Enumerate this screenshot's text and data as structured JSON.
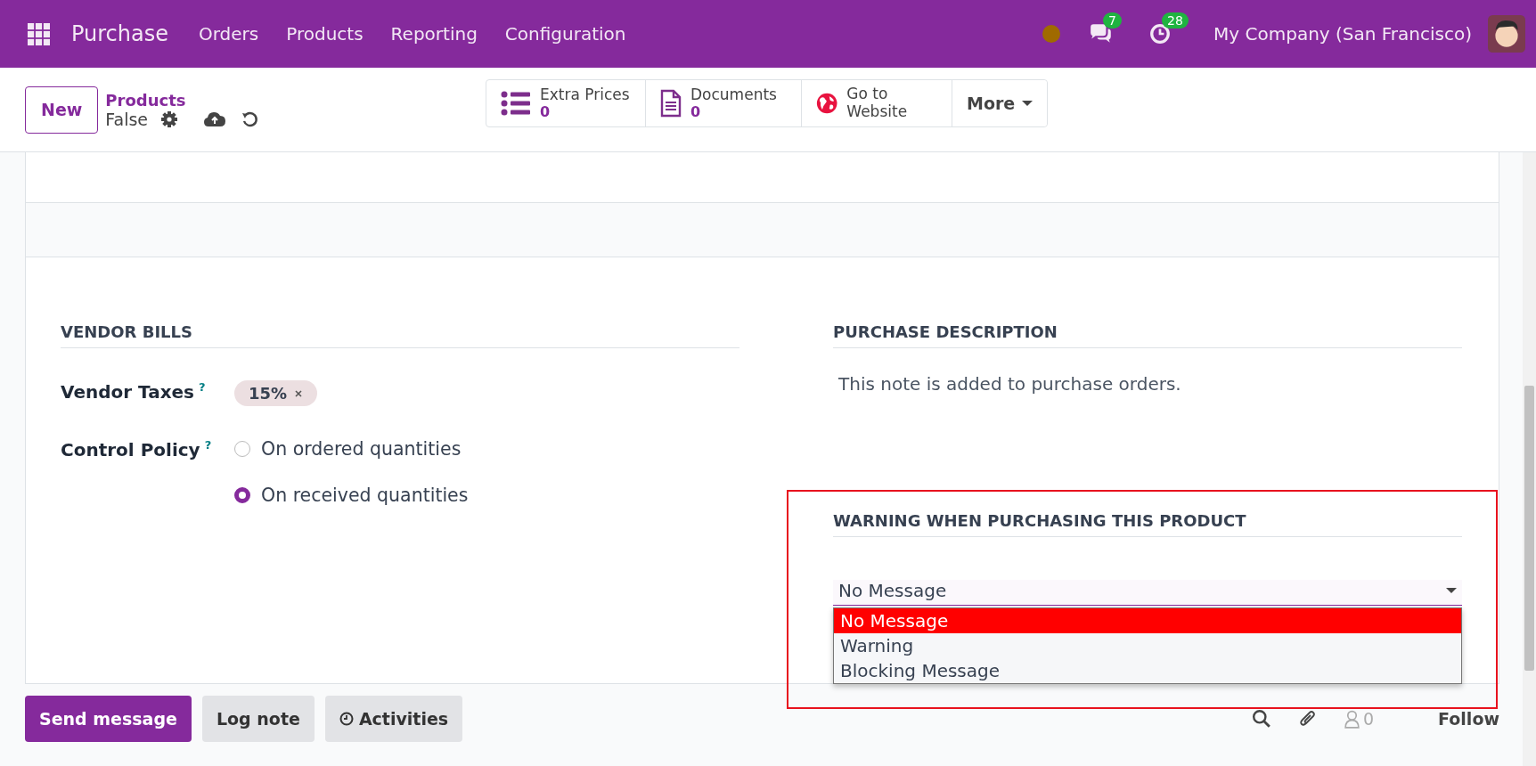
{
  "navbar": {
    "app_name": "Purchase",
    "menu": [
      "Orders",
      "Products",
      "Reporting",
      "Configuration"
    ],
    "messages_count": "7",
    "activities_count": "28",
    "company": "My Company (San Francisco)"
  },
  "control_panel": {
    "new_button": "New",
    "breadcrumb": "Products",
    "record_name": "False",
    "more_button": "More",
    "smart_buttons": [
      {
        "kind": "list",
        "label": "Extra Prices",
        "value": "0"
      },
      {
        "kind": "document",
        "label": "Documents",
        "value": "0"
      },
      {
        "kind": "globe",
        "label": "Go to Website"
      }
    ]
  },
  "vendor_bills": {
    "title": "VENDOR BILLS",
    "fields": [
      {
        "kind": "tags",
        "label": "Vendor Taxes",
        "help": "?",
        "tags": [
          "15%"
        ]
      },
      {
        "kind": "radio",
        "label": "Control Policy",
        "help": "?",
        "options": [
          {
            "label": "On ordered quantities",
            "selected": false
          },
          {
            "label": "On received quantities",
            "selected": true
          }
        ]
      }
    ]
  },
  "purchase_description": {
    "title": "PURCHASE DESCRIPTION",
    "placeholder": "This note is added to purchase orders."
  },
  "warning": {
    "title": "WARNING WHEN PURCHASING THIS PRODUCT",
    "value": "No Message",
    "expanded": true,
    "options": [
      {
        "label": "No Message",
        "selected": true
      },
      {
        "label": "Warning",
        "selected": false
      },
      {
        "label": "Blocking Message",
        "selected": false
      }
    ]
  },
  "chatter": {
    "buttons": [
      {
        "kind": "primary",
        "label": "Send message"
      },
      {
        "kind": "secondary",
        "label": "Log note"
      },
      {
        "kind": "activities",
        "label": "Activities"
      }
    ],
    "followers_count": "0",
    "follow": "Follow"
  }
}
